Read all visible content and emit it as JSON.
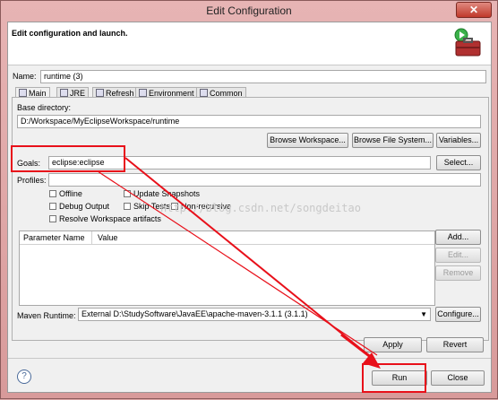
{
  "window": {
    "title": "Edit Configuration",
    "close_glyph": "✕"
  },
  "banner": {
    "title": "Edit configuration and launch.",
    "icon": "toolbox-run-icon"
  },
  "name": {
    "label": "Name:",
    "value": "runtime (3)"
  },
  "tabs": [
    {
      "label": "Main",
      "icon": "main-tab-icon",
      "active": true
    },
    {
      "label": "JRE",
      "icon": "jre-tab-icon"
    },
    {
      "label": "Refresh",
      "icon": "refresh-tab-icon"
    },
    {
      "label": "Environment",
      "icon": "environment-tab-icon"
    },
    {
      "label": "Common",
      "icon": "common-tab-icon"
    }
  ],
  "base_directory": {
    "label": "Base directory:",
    "value": "D:/Workspace/MyEclipseWorkspace/runtime",
    "buttons": [
      "Browse Workspace...",
      "Browse File System...",
      "Variables..."
    ]
  },
  "goals": {
    "label": "Goals:",
    "value": "eclipse:eclipse",
    "button": "Select..."
  },
  "profiles": {
    "label": "Profiles:",
    "value": ""
  },
  "options": [
    {
      "label": "Offline",
      "checked": false
    },
    {
      "label": "Update Snapshots",
      "checked": false
    },
    {
      "label": "Debug Output",
      "checked": false
    },
    {
      "label": "Skip Tests",
      "checked": false
    },
    {
      "label": "Non-recursive",
      "checked": false
    },
    {
      "label": "Resolve Workspace artifacts",
      "checked": false
    }
  ],
  "parameters": {
    "columns": [
      "Parameter Name",
      "Value"
    ],
    "rows": [],
    "buttons": {
      "add": "Add...",
      "edit": "Edit...",
      "remove": "Remove"
    }
  },
  "maven_runtime": {
    "label": "Maven Runtime:",
    "value": "External D:\\StudySoftware\\JavaEE\\apache-maven-3.1.1 (3.1.1)",
    "button": "Configure..."
  },
  "actions": {
    "apply": "Apply",
    "revert": "Revert",
    "run": "Run",
    "close": "Close",
    "help": "?"
  },
  "watermark": "http://blog.csdn.net/songdeitao",
  "colors": {
    "highlight": "#e8101a",
    "titlebar": "#d89a9a"
  }
}
